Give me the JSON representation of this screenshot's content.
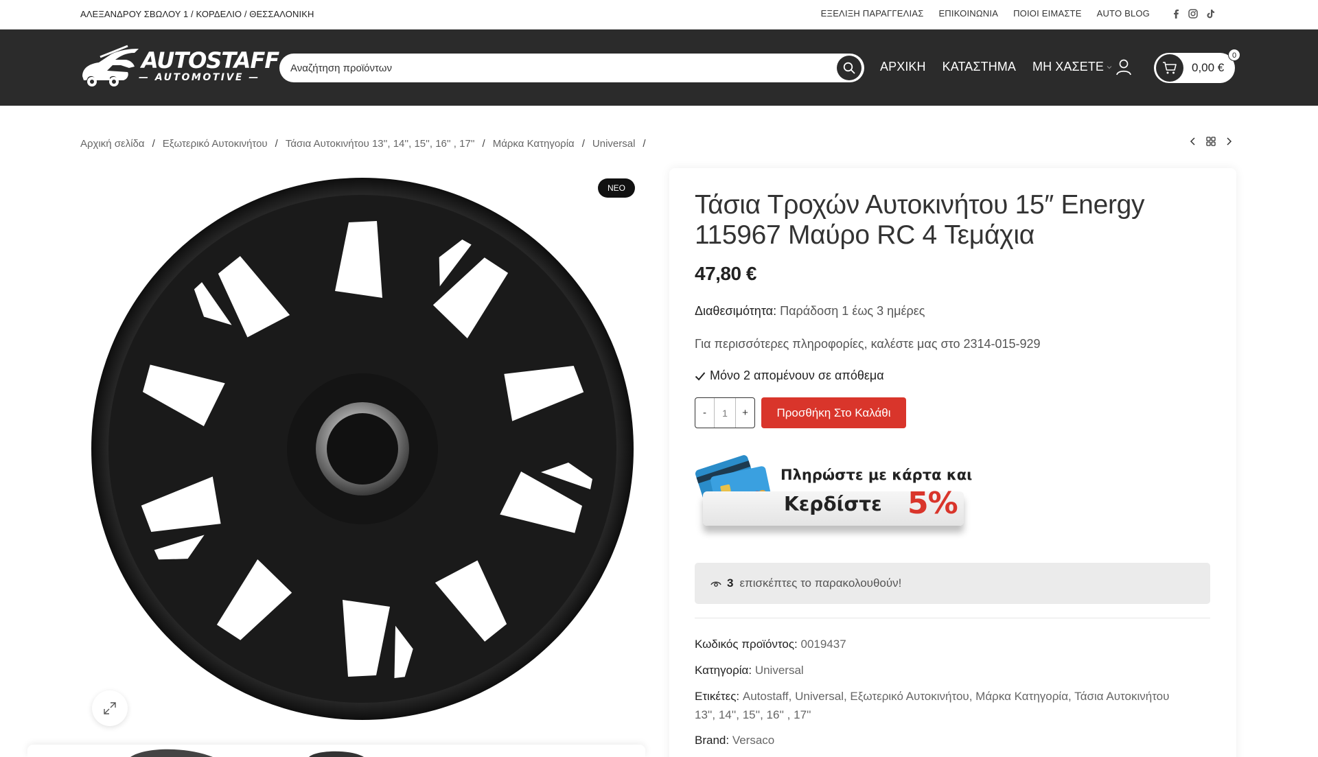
{
  "topbar": {
    "address": "ΑΛΕΞΑΝΔΡΟΥ ΣΒΩΛΟΥ 1 / ΚΟΡΔΕΛΙΟ / ΘΕΣΣΑΛΟΝΙΚΗ",
    "links": [
      "ΕΞΕΛΙΞΗ ΠΑΡΑΓΓΕΛΙΑΣ",
      "ΕΠΙΚΟΙΝΩΝΙΑ",
      "ΠΟΙΟΙ ΕΙΜΑΣΤΕ",
      "AUTO BLOG"
    ],
    "social_icons": [
      "facebook-icon",
      "instagram-icon",
      "tiktok-icon"
    ]
  },
  "header": {
    "logo_brand": "AUTOSTAFF",
    "logo_sub": "— AUTOMOTIVE —",
    "search_placeholder": "Αναζήτηση προϊόντων",
    "nav": [
      "ΑΡΧΙΚΗ",
      "ΚΑΤΑΣΤΗΜΑ",
      "ΜΗ ΧΑΣΕΤΕ"
    ],
    "cart_total": "0,00 €",
    "cart_count": "0"
  },
  "breadcrumb": [
    "Αρχική σελίδα",
    "Εξωτερικό Αυτοκινήτου",
    "Τάσια Αυτοκινήτου 13'', 14'', 15'', 16'' , 17''",
    "Μάρκα Κατηγορία",
    "Universal"
  ],
  "gallery": {
    "badge": "ΝΕΟ"
  },
  "product": {
    "title": "Τάσια Τροχών Αυτοκινήτου 15″ Energy 115967 Μαύρο RC 4 Τεμάχια",
    "price": "47,80 €",
    "availability_label": "Διαθεσιμότητα:",
    "availability_value": "Παράδοση 1 έως 3 ημέρες",
    "info": "Για περισσότερες πληροφορίες, καλέστε μας στο 2314-015-929",
    "stock": "Μόνο 2 απομένουν σε απόθεμα",
    "qty_minus": "-",
    "qty_value": "1",
    "qty_plus": "+",
    "add_to_cart": "Προσθήκη Στο Καλάθι",
    "promo_line1": "Πληρώστε με κάρτα και",
    "promo_line2": "Κερδίστε",
    "promo_pct": "5%",
    "viewers_count": "3",
    "viewers_text": "επισκέπτες το παρακολουθούν!",
    "sku_label": "Κωδικός προϊόντος:",
    "sku_value": "0019437",
    "category_label": "Κατηγορία:",
    "category_value": "Universal",
    "tags_label": "Ετικέτες:",
    "tags": [
      "Autostaff",
      "Universal",
      "Εξωτερικό Αυτοκινήτου",
      "Μάρκα Κατηγορία",
      "Τάσια Αυτοκινήτου 13'', 14'', 15'', 16'' , 17''"
    ],
    "brand_label": "Brand:",
    "brand_value": "Versaco"
  },
  "colors": {
    "header_bg": "#2b2b2b",
    "accent_red": "#d9352b"
  }
}
